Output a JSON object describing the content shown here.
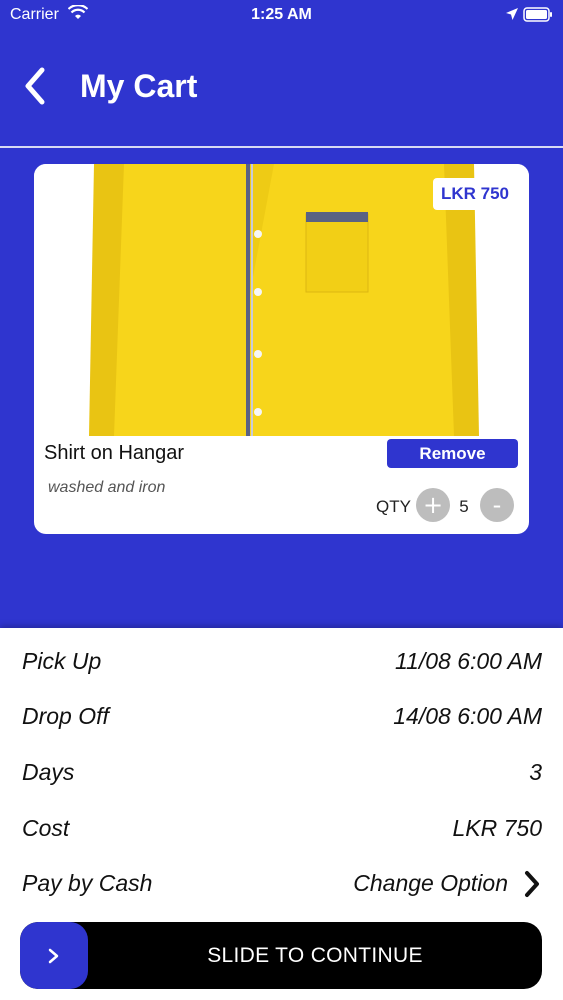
{
  "status_bar": {
    "carrier": "Carrier",
    "time": "1:25 AM"
  },
  "header": {
    "title": "My Cart",
    "back_icon": "chevron-left-icon"
  },
  "cart_item": {
    "name": "Shirt on Hangar",
    "description": "washed and iron",
    "price": "LKR 750",
    "remove_label": "Remove",
    "qty_label": "QTY",
    "qty_value": "5",
    "plus_label": "+",
    "minus_label": "-"
  },
  "summary": {
    "pickup_label": "Pick Up",
    "pickup_value": "11/08 6:00 AM",
    "dropoff_label": "Drop Off",
    "dropoff_value": "14/08 6:00 AM",
    "days_label": "Days",
    "days_value": "3",
    "cost_label": "Cost",
    "cost_value": "LKR 750",
    "payment_label": "Pay by Cash",
    "change_option_label": "Change Option"
  },
  "slider": {
    "text": "SLIDE TO CONTINUE"
  },
  "colors": {
    "primary": "#2f35cf",
    "product": "#f7d51b",
    "slider_bg": "#000000"
  }
}
